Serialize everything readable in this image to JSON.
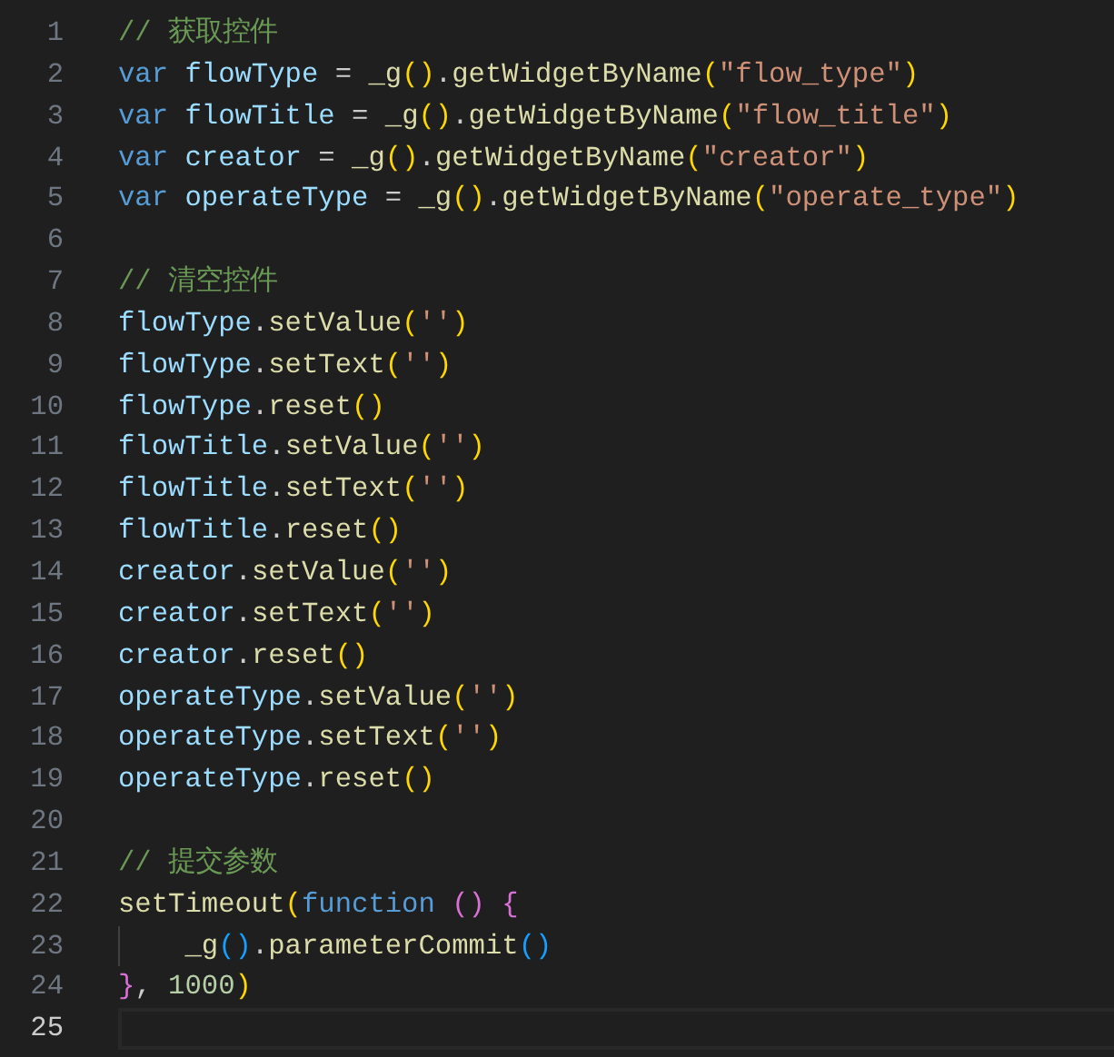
{
  "editor": {
    "lines": [
      {
        "number": "1",
        "current": false,
        "tokens": [
          {
            "kind": "comment",
            "text": "// 获取控件"
          }
        ]
      },
      {
        "number": "2",
        "current": false,
        "tokens": [
          {
            "kind": "keyword",
            "text": "var "
          },
          {
            "kind": "variable",
            "text": "flowType"
          },
          {
            "kind": "plain",
            "text": " = "
          },
          {
            "kind": "function",
            "text": "_g"
          },
          {
            "kind": "bracket1",
            "text": "()"
          },
          {
            "kind": "plain",
            "text": "."
          },
          {
            "kind": "function",
            "text": "getWidgetByName"
          },
          {
            "kind": "bracket1",
            "text": "("
          },
          {
            "kind": "string",
            "text": "\"flow_type\""
          },
          {
            "kind": "bracket1",
            "text": ")"
          }
        ]
      },
      {
        "number": "3",
        "current": false,
        "tokens": [
          {
            "kind": "keyword",
            "text": "var "
          },
          {
            "kind": "variable",
            "text": "flowTitle"
          },
          {
            "kind": "plain",
            "text": " = "
          },
          {
            "kind": "function",
            "text": "_g"
          },
          {
            "kind": "bracket1",
            "text": "()"
          },
          {
            "kind": "plain",
            "text": "."
          },
          {
            "kind": "function",
            "text": "getWidgetByName"
          },
          {
            "kind": "bracket1",
            "text": "("
          },
          {
            "kind": "string",
            "text": "\"flow_title\""
          },
          {
            "kind": "bracket1",
            "text": ")"
          }
        ]
      },
      {
        "number": "4",
        "current": false,
        "tokens": [
          {
            "kind": "keyword",
            "text": "var "
          },
          {
            "kind": "variable",
            "text": "creator"
          },
          {
            "kind": "plain",
            "text": " = "
          },
          {
            "kind": "function",
            "text": "_g"
          },
          {
            "kind": "bracket1",
            "text": "()"
          },
          {
            "kind": "plain",
            "text": "."
          },
          {
            "kind": "function",
            "text": "getWidgetByName"
          },
          {
            "kind": "bracket1",
            "text": "("
          },
          {
            "kind": "string",
            "text": "\"creator\""
          },
          {
            "kind": "bracket1",
            "text": ")"
          }
        ]
      },
      {
        "number": "5",
        "current": false,
        "tokens": [
          {
            "kind": "keyword",
            "text": "var "
          },
          {
            "kind": "variable",
            "text": "operateType"
          },
          {
            "kind": "plain",
            "text": " = "
          },
          {
            "kind": "function",
            "text": "_g"
          },
          {
            "kind": "bracket1",
            "text": "()"
          },
          {
            "kind": "plain",
            "text": "."
          },
          {
            "kind": "function",
            "text": "getWidgetByName"
          },
          {
            "kind": "bracket1",
            "text": "("
          },
          {
            "kind": "string",
            "text": "\"operate_type\""
          },
          {
            "kind": "bracket1",
            "text": ")"
          }
        ]
      },
      {
        "number": "6",
        "current": false
      },
      {
        "number": "7",
        "current": false,
        "tokens": [
          {
            "kind": "comment",
            "text": "// 清空控件"
          }
        ]
      },
      {
        "number": "8",
        "current": false,
        "tokens": [
          {
            "kind": "variable",
            "text": "flowType"
          },
          {
            "kind": "plain",
            "text": "."
          },
          {
            "kind": "function",
            "text": "setValue"
          },
          {
            "kind": "bracket1",
            "text": "("
          },
          {
            "kind": "string",
            "text": "''"
          },
          {
            "kind": "bracket1",
            "text": ")"
          }
        ]
      },
      {
        "number": "9",
        "current": false,
        "tokens": [
          {
            "kind": "variable",
            "text": "flowType"
          },
          {
            "kind": "plain",
            "text": "."
          },
          {
            "kind": "function",
            "text": "setText"
          },
          {
            "kind": "bracket1",
            "text": "("
          },
          {
            "kind": "string",
            "text": "''"
          },
          {
            "kind": "bracket1",
            "text": ")"
          }
        ]
      },
      {
        "number": "10",
        "current": false,
        "tokens": [
          {
            "kind": "variable",
            "text": "flowType"
          },
          {
            "kind": "plain",
            "text": "."
          },
          {
            "kind": "function",
            "text": "reset"
          },
          {
            "kind": "bracket1",
            "text": "()"
          }
        ]
      },
      {
        "number": "11",
        "current": false,
        "tokens": [
          {
            "kind": "variable",
            "text": "flowTitle"
          },
          {
            "kind": "plain",
            "text": "."
          },
          {
            "kind": "function",
            "text": "setValue"
          },
          {
            "kind": "bracket1",
            "text": "("
          },
          {
            "kind": "string",
            "text": "''"
          },
          {
            "kind": "bracket1",
            "text": ")"
          }
        ]
      },
      {
        "number": "12",
        "current": false,
        "tokens": [
          {
            "kind": "variable",
            "text": "flowTitle"
          },
          {
            "kind": "plain",
            "text": "."
          },
          {
            "kind": "function",
            "text": "setText"
          },
          {
            "kind": "bracket1",
            "text": "("
          },
          {
            "kind": "string",
            "text": "''"
          },
          {
            "kind": "bracket1",
            "text": ")"
          }
        ]
      },
      {
        "number": "13",
        "current": false,
        "tokens": [
          {
            "kind": "variable",
            "text": "flowTitle"
          },
          {
            "kind": "plain",
            "text": "."
          },
          {
            "kind": "function",
            "text": "reset"
          },
          {
            "kind": "bracket1",
            "text": "()"
          }
        ]
      },
      {
        "number": "14",
        "current": false,
        "tokens": [
          {
            "kind": "variable",
            "text": "creator"
          },
          {
            "kind": "plain",
            "text": "."
          },
          {
            "kind": "function",
            "text": "setValue"
          },
          {
            "kind": "bracket1",
            "text": "("
          },
          {
            "kind": "string",
            "text": "''"
          },
          {
            "kind": "bracket1",
            "text": ")"
          }
        ]
      },
      {
        "number": "15",
        "current": false,
        "tokens": [
          {
            "kind": "variable",
            "text": "creator"
          },
          {
            "kind": "plain",
            "text": "."
          },
          {
            "kind": "function",
            "text": "setText"
          },
          {
            "kind": "bracket1",
            "text": "("
          },
          {
            "kind": "string",
            "text": "''"
          },
          {
            "kind": "bracket1",
            "text": ")"
          }
        ]
      },
      {
        "number": "16",
        "current": false,
        "tokens": [
          {
            "kind": "variable",
            "text": "creator"
          },
          {
            "kind": "plain",
            "text": "."
          },
          {
            "kind": "function",
            "text": "reset"
          },
          {
            "kind": "bracket1",
            "text": "()"
          }
        ]
      },
      {
        "number": "17",
        "current": false,
        "tokens": [
          {
            "kind": "variable",
            "text": "operateType"
          },
          {
            "kind": "plain",
            "text": "."
          },
          {
            "kind": "function",
            "text": "setValue"
          },
          {
            "kind": "bracket1",
            "text": "("
          },
          {
            "kind": "string",
            "text": "''"
          },
          {
            "kind": "bracket1",
            "text": ")"
          }
        ]
      },
      {
        "number": "18",
        "current": false,
        "tokens": [
          {
            "kind": "variable",
            "text": "operateType"
          },
          {
            "kind": "plain",
            "text": "."
          },
          {
            "kind": "function",
            "text": "setText"
          },
          {
            "kind": "bracket1",
            "text": "("
          },
          {
            "kind": "string",
            "text": "''"
          },
          {
            "kind": "bracket1",
            "text": ")"
          }
        ]
      },
      {
        "number": "19",
        "current": false,
        "tokens": [
          {
            "kind": "variable",
            "text": "operateType"
          },
          {
            "kind": "plain",
            "text": "."
          },
          {
            "kind": "function",
            "text": "reset"
          },
          {
            "kind": "bracket1",
            "text": "()"
          }
        ]
      },
      {
        "number": "20",
        "current": false
      },
      {
        "number": "21",
        "current": false,
        "tokens": [
          {
            "kind": "comment",
            "text": "// 提交参数"
          }
        ]
      },
      {
        "number": "22",
        "current": false,
        "tokens": [
          {
            "kind": "function",
            "text": "setTimeout"
          },
          {
            "kind": "bracket1",
            "text": "("
          },
          {
            "kind": "keyword",
            "text": "function "
          },
          {
            "kind": "bracket2",
            "text": "() {"
          }
        ]
      },
      {
        "number": "23",
        "current": false,
        "tokens": [
          {
            "kind": "function",
            "text": "    _g"
          },
          {
            "kind": "bracket3",
            "text": "()"
          },
          {
            "kind": "plain",
            "text": "."
          },
          {
            "kind": "function",
            "text": "parameterCommit"
          },
          {
            "kind": "bracket3",
            "text": "()"
          }
        ]
      },
      {
        "number": "24",
        "current": false,
        "tokens": [
          {
            "kind": "bracket2",
            "text": "}"
          },
          {
            "kind": "plain",
            "text": ", "
          },
          {
            "kind": "number",
            "text": "1000"
          },
          {
            "kind": "bracket1",
            "text": ")"
          }
        ]
      },
      {
        "number": "25",
        "current": true
      }
    ]
  }
}
